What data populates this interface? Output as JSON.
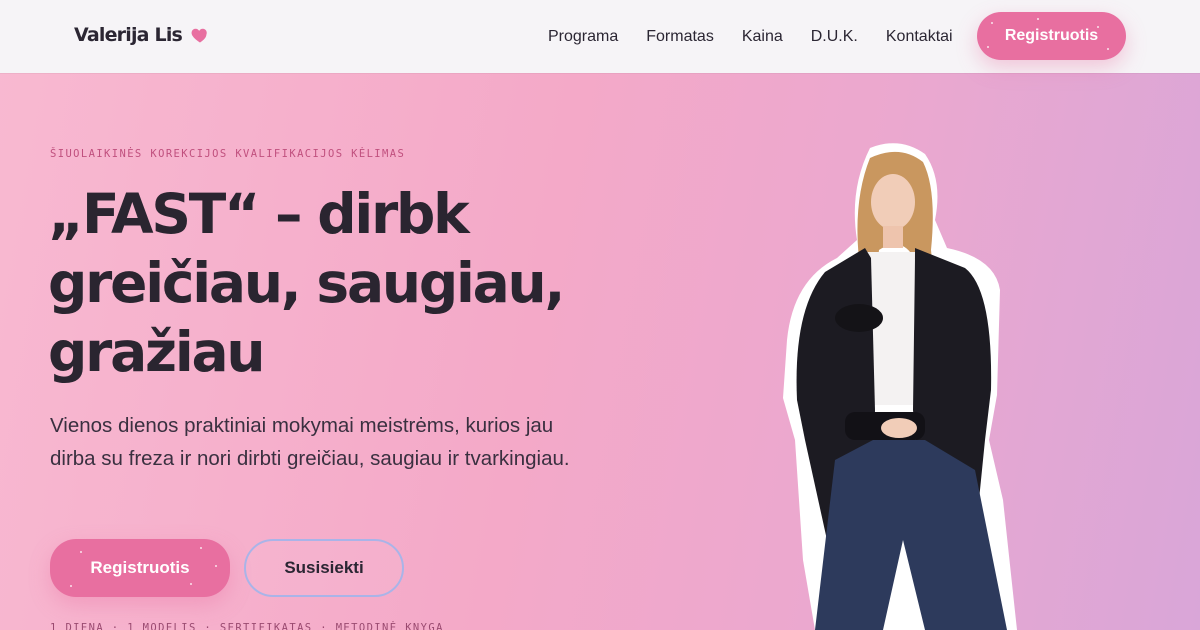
{
  "header": {
    "logo_text": "Valerija Lis",
    "logo_icon": "heart-icon",
    "nav": [
      "Programa",
      "Formatas",
      "Kaina",
      "D.U.K.",
      "Kontaktai"
    ],
    "cta_label": "Registruotis"
  },
  "hero": {
    "eyebrow": "ŠIUOLAIKINĖS KOREKCIJOS KVALIFIKACIJOS KĖLIMAS",
    "headline": "„FAST“ – dirbk greičiau, saugiau, gražiau",
    "subtext": "Vienos dienos praktiniai mokymai meistrėms, kurios jau dirba su freza ir nori dirbti greičiau, saugiau ir tvarkingiau.",
    "primary_cta": "Registruotis",
    "secondary_cta": "Susisiekti",
    "footnote": "1 DIENA · 1 MODELIS · SERTIFIKATAS · METODINĖ KNYGA"
  },
  "colors": {
    "accent": "#e86fa0",
    "header_bg": "#f6f4f7",
    "hero_bg_start": "#f8b9d1",
    "hero_bg_end": "#d9a6d8",
    "text_dark": "#2a2530",
    "eyebrow": "#c0507e",
    "secondary_border": "#a9b4e8"
  }
}
